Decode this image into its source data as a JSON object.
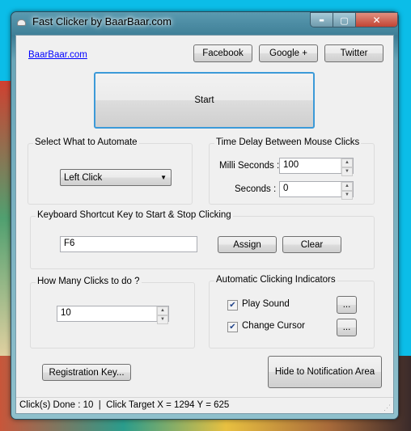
{
  "window": {
    "title": "Fast Clicker by BaarBaar.com",
    "minimize": "▬",
    "maximize": "▢",
    "close": "✕"
  },
  "header": {
    "link": "BaarBaar.com",
    "facebook": "Facebook",
    "google": "Google +",
    "twitter": "Twitter"
  },
  "start_label": "Start",
  "automate": {
    "title": "Select What to Automate",
    "selected": "Left Click"
  },
  "delay": {
    "title": "Time Delay Between Mouse Clicks",
    "ms_label": "Milli Seconds :",
    "ms_value": "100",
    "sec_label": "Seconds :",
    "sec_value": "0"
  },
  "shortcut": {
    "title": "Keyboard Shortcut Key to Start & Stop Clicking",
    "value": "F6",
    "assign": "Assign",
    "clear": "Clear"
  },
  "clicks": {
    "title": "How Many Clicks to do ?",
    "value": "10"
  },
  "indicators": {
    "title": "Automatic Clicking Indicators",
    "play_sound": "Play Sound",
    "play_sound_checked": true,
    "change_cursor": "Change Cursor",
    "change_cursor_checked": true,
    "browse": "..."
  },
  "registration": "Registration Key...",
  "hide": "Hide to Notification Area",
  "status": "Click(s) Done : 10  |  Click Target X = 1294 Y = 625",
  "colors": {
    "link": "#0000ff",
    "focus_border": "#3c9ad8"
  }
}
